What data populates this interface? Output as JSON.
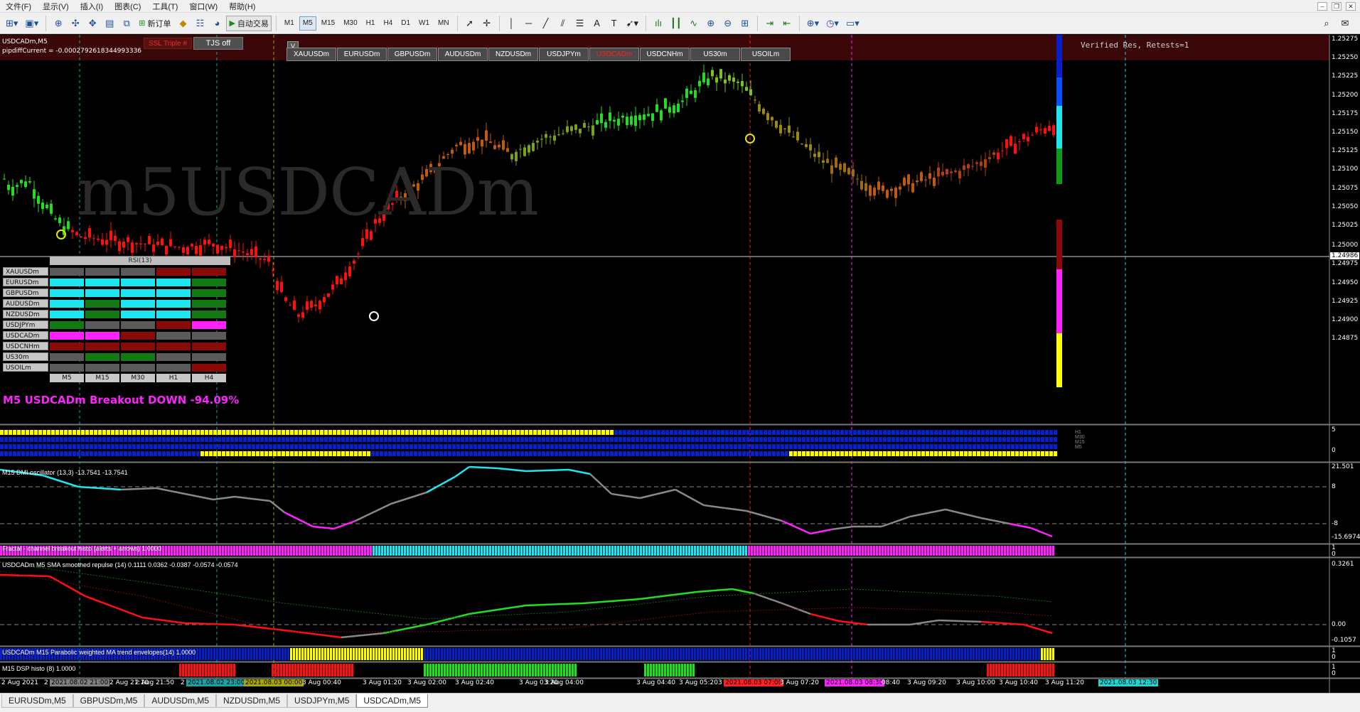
{
  "menu": [
    "文件(F)",
    "显示(V)",
    "插入(I)",
    "图表(C)",
    "工具(T)",
    "窗口(W)",
    "帮助(H)"
  ],
  "toolbar": {
    "new_order": "新订单",
    "auto_trade": "自动交易",
    "timeframes": [
      "M1",
      "M5",
      "M15",
      "M30",
      "H1",
      "H4",
      "D1",
      "W1",
      "MN"
    ],
    "active_timeframe": "M5"
  },
  "chart": {
    "header": "USDCADm,M5",
    "pipdiff": "pipdiffCurrent = -0.0002792618344993336",
    "watermark": "m5USDCADm",
    "verified": "Verified Res, Retests=1",
    "ssl_button": "SSL Triple #",
    "tjs_button": "TJS off",
    "v_button": "V",
    "symbols": [
      "XAUUSDm",
      "EURUSDm",
      "GBPUSDm",
      "AUDUSDm",
      "NZDUSDm",
      "USDJPYm",
      "USDCADm",
      "USDCNHm",
      "US30m",
      "USOILm"
    ],
    "active_symbol": "USDCADm",
    "current_price": "1.24986",
    "price_axis": [
      "1.25275",
      "1.25250",
      "1.25225",
      "1.25200",
      "1.25175",
      "1.25150",
      "1.25125",
      "1.25100",
      "1.25075",
      "1.25050",
      "1.25025",
      "1.25000",
      "1.24975",
      "1.24950",
      "1.24925",
      "1.24900",
      "1.24875"
    ],
    "breakout": "M5 USDCADm Breakout DOWN -94.09%"
  },
  "rsi_table": {
    "title": "RSI(13)",
    "timeframes": [
      "M5",
      "M15",
      "M30",
      "H1",
      "H4"
    ],
    "rows": [
      {
        "symbol": "XAUUSDm",
        "cells": [
          "gray",
          "gray",
          "gray",
          "darkred",
          "darkred"
        ]
      },
      {
        "symbol": "EURUSDm",
        "cells": [
          "cyan",
          "cyan",
          "cyan",
          "cyan",
          "green"
        ]
      },
      {
        "symbol": "GBPUSDm",
        "cells": [
          "cyan",
          "cyan",
          "cyan",
          "cyan",
          "green"
        ]
      },
      {
        "symbol": "AUDUSDm",
        "cells": [
          "cyan",
          "green",
          "cyan",
          "cyan",
          "green"
        ]
      },
      {
        "symbol": "NZDUSDm",
        "cells": [
          "cyan",
          "green",
          "cyan",
          "cyan",
          "green"
        ]
      },
      {
        "symbol": "USDJPYm",
        "cells": [
          "green",
          "gray",
          "gray",
          "darkred",
          "magenta"
        ]
      },
      {
        "symbol": "USDCADm",
        "cells": [
          "magenta",
          "magenta",
          "darkred",
          "gray",
          "gray"
        ]
      },
      {
        "symbol": "USDCNHm",
        "cells": [
          "darkred",
          "darkred",
          "darkred",
          "darkred",
          "darkred"
        ]
      },
      {
        "symbol": "US30m",
        "cells": [
          "gray",
          "green",
          "green",
          "gray",
          "gray"
        ]
      },
      {
        "symbol": "USOILm",
        "cells": [
          "gray",
          "gray",
          "gray",
          "gray",
          "darkred"
        ]
      }
    ]
  },
  "indicators": {
    "mtf_histo": {
      "axis": [
        "5",
        "0"
      ],
      "labels": [
        "H1",
        "M30",
        "M15",
        "M5"
      ]
    },
    "dmi": {
      "title": "M15 DMI oscillator (13,3) -13.7541 -13.7541",
      "axis": [
        "21.501",
        "8",
        "-8",
        "-15.6974"
      ]
    },
    "fractal": {
      "title": "Fractal - channel breakout histo (alerts + arrows) 1.0000",
      "axis": [
        "1",
        "0"
      ]
    },
    "repulse": {
      "title": "USDCADm M5 SMA smoothed repulse (14) 0.1111 0.0362 -0.0387 -0.0574 -0.0574",
      "axis": [
        "0.3261",
        "0.00",
        "-0.1057"
      ]
    },
    "parabolic": {
      "title": "USDCADm M15 Parabolic weighted MA trend envelopes(14) 1.0000",
      "axis": [
        "1",
        "0"
      ]
    },
    "dsp": {
      "title": "M15 DSP histo (8) 1.0000",
      "axis": [
        "1",
        "0"
      ]
    }
  },
  "time_axis": [
    {
      "text": "2 Aug 2021",
      "hl": ""
    },
    {
      "text": "2",
      "hl": ""
    },
    {
      "text": "2021.08.02 21:00",
      "hl": "#808080"
    },
    {
      "text": "2 Aug 21:10",
      "hl": ""
    },
    {
      "text": "2 Aug 21:50",
      "hl": ""
    },
    {
      "text": "2",
      "hl": ""
    },
    {
      "text": "2021.08.02 23:00",
      "hl": "#1aa3a3"
    },
    {
      "text": "2021.08.03 00:00",
      "hl": "#a8a800"
    },
    {
      "text": "3 Aug 00:40",
      "hl": ""
    },
    {
      "text": "3 Aug 01:20",
      "hl": ""
    },
    {
      "text": "3 Aug 02:00",
      "hl": ""
    },
    {
      "text": "3 Aug 02:40",
      "hl": ""
    },
    {
      "text": "3 Aug 03:20",
      "hl": ""
    },
    {
      "text": "3 Aug 04:00",
      "hl": ""
    },
    {
      "text": "3 Aug 04:40",
      "hl": ""
    },
    {
      "text": "3 Aug 05:20",
      "hl": ""
    },
    {
      "text": "3 Aug 06:00",
      "hl": ""
    },
    {
      "text": "2021.08.03 07:00",
      "hl": "#ff2020"
    },
    {
      "text": "3 Aug 07:20",
      "hl": ""
    },
    {
      "text": "2021.08.03 08:30",
      "hl": "#ff22ff"
    },
    {
      "text": "08:40",
      "hl": ""
    },
    {
      "text": "3 Aug 09:20",
      "hl": ""
    },
    {
      "text": "3 Aug 10:00",
      "hl": ""
    },
    {
      "text": "3 Aug 10:40",
      "hl": ""
    },
    {
      "text": "3 Aug 11:20",
      "hl": ""
    },
    {
      "text": "2021.08.03 12:30",
      "hl": "#1ad6d6"
    }
  ],
  "tabs": [
    "EURUSDm,M5",
    "GBPUSDm,M5",
    "AUDUSDm,M5",
    "NZDUSDm,M5",
    "USDJPYm,M5",
    "USDCADm,M5"
  ],
  "active_tab": "USDCADm,M5",
  "colors": {
    "bull": "#22dd22",
    "bear": "#ff1010",
    "cyan": "#1ee6f0",
    "magenta": "#ff22ff",
    "yellow": "#ffff00",
    "blue": "#0a1fcc"
  }
}
